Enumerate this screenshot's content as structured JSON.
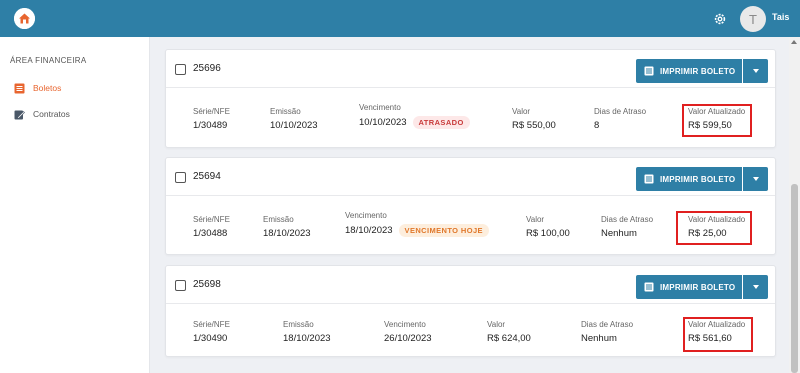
{
  "header": {
    "user_initial": "T",
    "user_name": "Tais",
    "icons": [
      "home-logo-icon",
      "gear-icon"
    ]
  },
  "sidebar": {
    "section_title": "ÁREA FINANCEIRA",
    "items": [
      {
        "label": "Boletos",
        "icon": "document-list-icon",
        "active": true
      },
      {
        "label": "Contratos",
        "icon": "edit-document-icon",
        "active": false
      }
    ]
  },
  "labels": {
    "serie": "Série/NFE",
    "emissao": "Emissão",
    "vencimento": "Vencimento",
    "valor": "Valor",
    "dias_atraso": "Dias de Atraso",
    "valor_atualizado": "Valor Atualizado",
    "print_button": "IMPRIMIR BOLETO"
  },
  "boletos": [
    {
      "id": "25696",
      "serie": "1/30489",
      "emissao": "10/10/2023",
      "vencimento": "10/10/2023",
      "status": "ATRASADO",
      "valor": "R$ 550,00",
      "dias_atraso": "8",
      "valor_atualizado": "R$ 599,50"
    },
    {
      "id": "25694",
      "serie": "1/30488",
      "emissao": "18/10/2023",
      "vencimento": "18/10/2023",
      "status": "VENCIMENTO HOJE",
      "valor": "R$ 100,00",
      "dias_atraso": "Nenhum",
      "valor_atualizado": "R$ 25,00"
    },
    {
      "id": "25698",
      "serie": "1/30490",
      "emissao": "18/10/2023",
      "vencimento": "26/10/2023",
      "status": "",
      "valor": "R$ 624,00",
      "dias_atraso": "Nenhum",
      "valor_atualizado": "R$ 561,60"
    }
  ],
  "colors": {
    "primary": "#2e7fa6",
    "accent": "#e8652f",
    "late_badge": "#c83a3a",
    "today_badge": "#e0782b",
    "highlight": "#e02020"
  }
}
